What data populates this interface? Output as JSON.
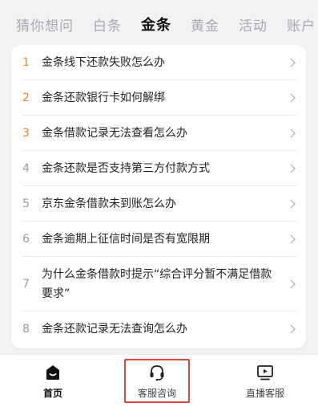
{
  "tabs": [
    {
      "label": "猜你想问",
      "active": false
    },
    {
      "label": "白条",
      "active": false
    },
    {
      "label": "金条",
      "active": true
    },
    {
      "label": "黄金",
      "active": false
    },
    {
      "label": "活动",
      "active": false
    },
    {
      "label": "账户",
      "active": false
    }
  ],
  "questions": [
    {
      "num": "1",
      "text": "金条线下还款失败怎么办"
    },
    {
      "num": "2",
      "text": "金条还款银行卡如何解绑"
    },
    {
      "num": "3",
      "text": "金条借款记录无法查看怎么办"
    },
    {
      "num": "4",
      "text": "金条还款是否支持第三方付款方式"
    },
    {
      "num": "5",
      "text": "京东金条借款未到账怎么办"
    },
    {
      "num": "6",
      "text": "金条逾期上征信时间是否有宽限期"
    },
    {
      "num": "7",
      "text": "为什么金条借款时提示“综合评分暂不满足借款要求”"
    },
    {
      "num": "8",
      "text": "金条还款记录无法查询怎么办"
    }
  ],
  "colors": {
    "hot_number": "#e58a2b",
    "normal_number": "#9b9b9f",
    "highlight_border": "#e0443b"
  },
  "bottom_nav": {
    "home": {
      "label": "首页",
      "icon": "home-icon"
    },
    "service": {
      "label": "客服咨询",
      "icon": "headset-icon"
    },
    "live": {
      "label": "直播客服",
      "icon": "live-tv-icon"
    }
  }
}
